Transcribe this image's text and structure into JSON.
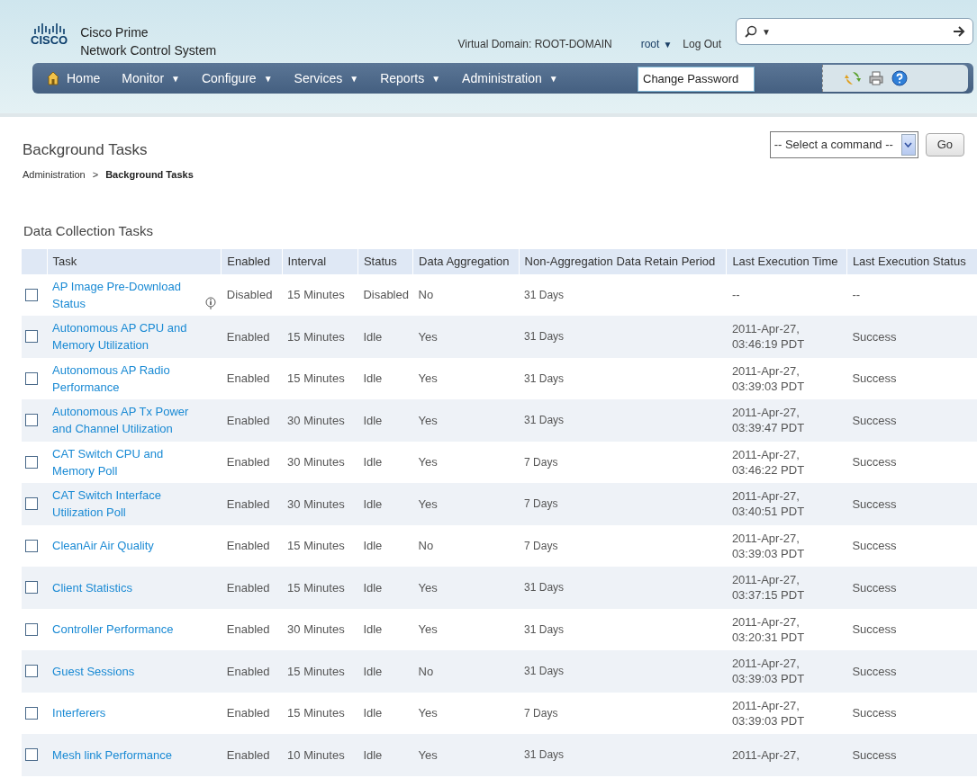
{
  "header": {
    "brand_line1": "Cisco Prime",
    "brand_line2": "Network Control System",
    "logo_text": "CISCO",
    "virtual_domain": "Virtual Domain: ROOT-DOMAIN",
    "user": "root",
    "user_caret": "▼",
    "logout": "Log Out",
    "search": {
      "caret": "▼"
    }
  },
  "nav": {
    "items": [
      {
        "label": "Home",
        "kind": "home"
      },
      {
        "label": "Monitor",
        "kind": "menu",
        "caret": "▼"
      },
      {
        "label": "Configure",
        "kind": "menu",
        "caret": "▼"
      },
      {
        "label": "Services",
        "kind": "menu",
        "caret": "▼"
      },
      {
        "label": "Reports",
        "kind": "menu",
        "caret": "▼"
      },
      {
        "label": "Administration",
        "kind": "menu",
        "caret": "▼"
      }
    ]
  },
  "user_menu": {
    "items": [
      "Change Password"
    ]
  },
  "page": {
    "title": "Background Tasks",
    "breadcrumb": [
      {
        "label": "Administration",
        "current": false
      },
      {
        "label": "Background Tasks",
        "current": true
      }
    ],
    "breadcrumb_sep": ">",
    "command_select": {
      "value": "-- Select a command --"
    },
    "go_button": "Go"
  },
  "table": {
    "title": "Data Collection Tasks",
    "columns": [
      "Task",
      "Enabled",
      "Interval",
      "Status",
      "Data Aggregation",
      "Non-Aggregation Data Retain Period",
      "Last Execution Time",
      "Last Execution Status"
    ],
    "rows": [
      {
        "checked": false,
        "task": "AP Image Pre-Download Status",
        "info_icon": true,
        "enabled": "Disabled",
        "interval": "15 Minutes",
        "status": "Disabled",
        "aggregation": "No",
        "retain": "31 Days",
        "last_time": [
          "--"
        ],
        "last_status": "--"
      },
      {
        "checked": false,
        "task": "Autonomous AP CPU and Memory Utilization",
        "info_icon": false,
        "enabled": "Enabled",
        "interval": "15 Minutes",
        "status": "Idle",
        "aggregation": "Yes",
        "retain": "31 Days",
        "last_time": [
          "2011-Apr-27,",
          "03:46:19 PDT"
        ],
        "last_status": "Success"
      },
      {
        "checked": false,
        "task": "Autonomous AP Radio Performance",
        "info_icon": false,
        "enabled": "Enabled",
        "interval": "15 Minutes",
        "status": "Idle",
        "aggregation": "Yes",
        "retain": "31 Days",
        "last_time": [
          "2011-Apr-27,",
          "03:39:03 PDT"
        ],
        "last_status": "Success"
      },
      {
        "checked": false,
        "task": "Autonomous AP Tx Power and Channel Utilization",
        "info_icon": false,
        "enabled": "Enabled",
        "interval": "30 Minutes",
        "status": "Idle",
        "aggregation": "Yes",
        "retain": "31 Days",
        "last_time": [
          "2011-Apr-27,",
          "03:39:47 PDT"
        ],
        "last_status": "Success"
      },
      {
        "checked": false,
        "task": "CAT Switch CPU and Memory Poll",
        "info_icon": false,
        "enabled": "Enabled",
        "interval": "30 Minutes",
        "status": "Idle",
        "aggregation": "Yes",
        "retain": "7 Days",
        "last_time": [
          "2011-Apr-27,",
          "03:46:22 PDT"
        ],
        "last_status": "Success"
      },
      {
        "checked": false,
        "task": "CAT Switch Interface Utilization Poll",
        "info_icon": false,
        "enabled": "Enabled",
        "interval": "30 Minutes",
        "status": "Idle",
        "aggregation": "Yes",
        "retain": "7 Days",
        "last_time": [
          "2011-Apr-27,",
          "03:40:51 PDT"
        ],
        "last_status": "Success"
      },
      {
        "checked": false,
        "task": "CleanAir Air Quality",
        "info_icon": false,
        "enabled": "Enabled",
        "interval": "15 Minutes",
        "status": "Idle",
        "aggregation": "No",
        "retain": "7 Days",
        "last_time": [
          "2011-Apr-27,",
          "03:39:03 PDT"
        ],
        "last_status": "Success"
      },
      {
        "checked": false,
        "task": "Client Statistics",
        "info_icon": false,
        "enabled": "Enabled",
        "interval": "15 Minutes",
        "status": "Idle",
        "aggregation": "Yes",
        "retain": "31 Days",
        "last_time": [
          "2011-Apr-27,",
          "03:37:15 PDT"
        ],
        "last_status": "Success"
      },
      {
        "checked": false,
        "task": "Controller Performance",
        "info_icon": false,
        "enabled": "Enabled",
        "interval": "30 Minutes",
        "status": "Idle",
        "aggregation": "Yes",
        "retain": "31 Days",
        "last_time": [
          "2011-Apr-27,",
          "03:20:31 PDT"
        ],
        "last_status": "Success"
      },
      {
        "checked": false,
        "task": "Guest Sessions",
        "info_icon": false,
        "enabled": "Enabled",
        "interval": "15 Minutes",
        "status": "Idle",
        "aggregation": "No",
        "retain": "31 Days",
        "last_time": [
          "2011-Apr-27,",
          "03:39:03 PDT"
        ],
        "last_status": "Success"
      },
      {
        "checked": false,
        "task": "Interferers",
        "info_icon": false,
        "enabled": "Enabled",
        "interval": "15 Minutes",
        "status": "Idle",
        "aggregation": "Yes",
        "retain": "7 Days",
        "last_time": [
          "2011-Apr-27,",
          "03:39:03 PDT"
        ],
        "last_status": "Success"
      },
      {
        "checked": false,
        "task": "Mesh link Performance",
        "info_icon": false,
        "enabled": "Enabled",
        "interval": "10 Minutes",
        "status": "Idle",
        "aggregation": "Yes",
        "retain": "31 Days",
        "last_time": [
          "2011-Apr-27,"
        ],
        "last_status": "Success"
      }
    ]
  }
}
